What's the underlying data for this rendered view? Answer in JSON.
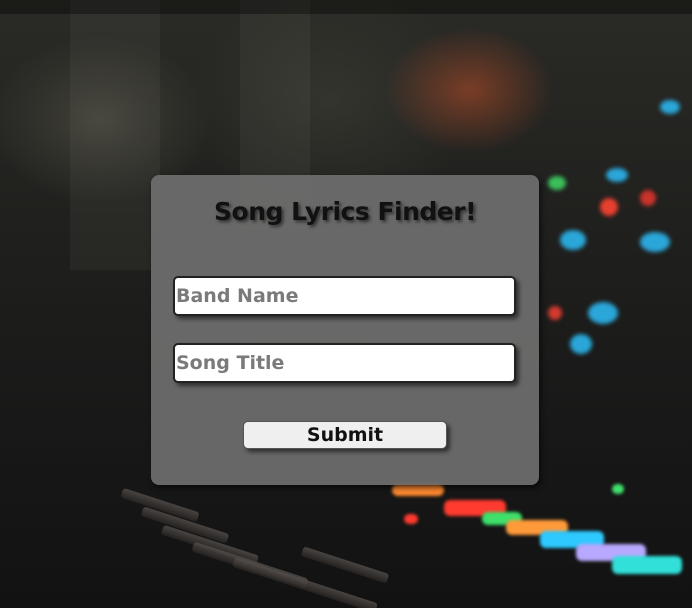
{
  "form": {
    "title": "Song Lyrics Finder!",
    "band_name": {
      "placeholder": "Band Name",
      "value": ""
    },
    "song_title": {
      "placeholder": "Song Title",
      "value": ""
    },
    "submit_label": "Submit"
  },
  "background": {
    "description_icon": "studio-mixing-console-photo",
    "accent_colors": [
      "#ff3b2f",
      "#2ec9ff",
      "#3ee06a",
      "#ff9a3a",
      "#b9a8ff",
      "#31e0d8"
    ]
  }
}
